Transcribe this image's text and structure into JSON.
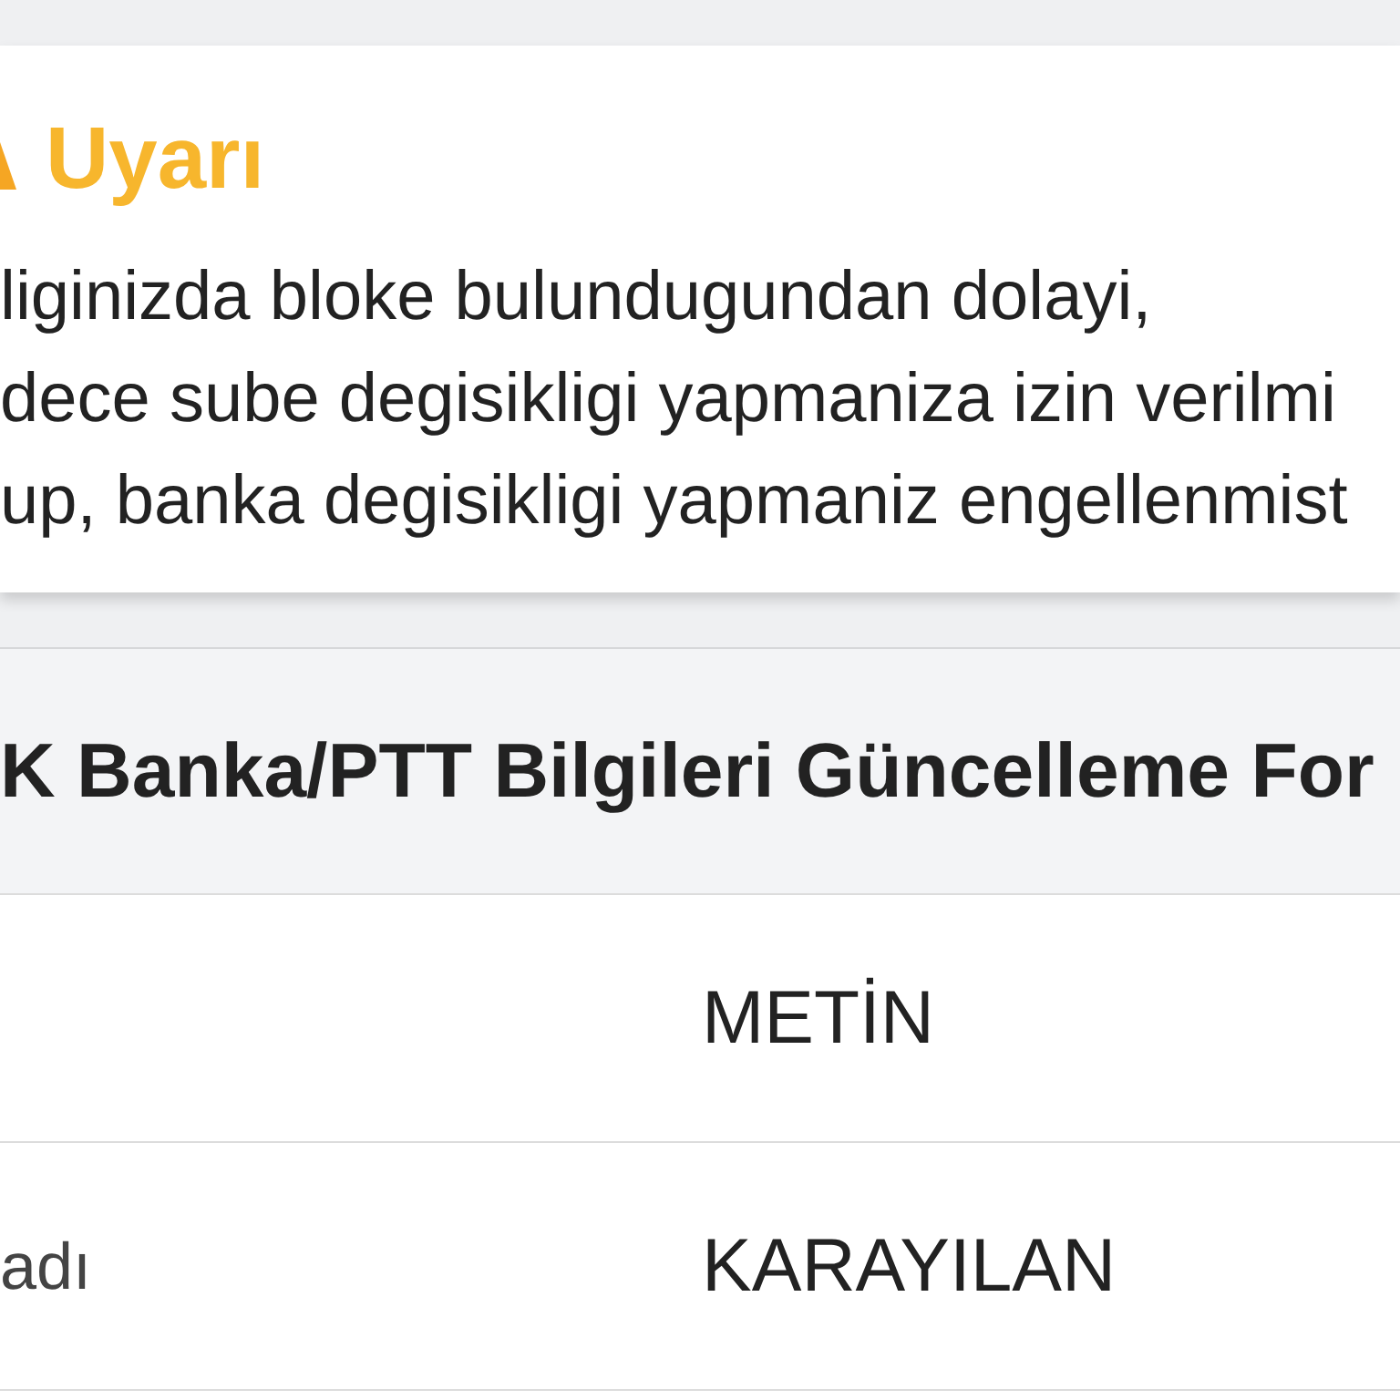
{
  "warning": {
    "title": "Uyarı",
    "lines": [
      "liginizda bloke bulundugundan dolayi,",
      "dece sube degisikligi yapmaniza izin verilmi",
      "up, banka degisikligi yapmaniz engellenmist"
    ]
  },
  "form_table": {
    "title": "K Banka/PTT Bilgileri Güncelleme For",
    "rows": [
      {
        "value": "METİN"
      },
      {
        "label": "adı",
        "value": "KARAYILAN"
      }
    ]
  }
}
